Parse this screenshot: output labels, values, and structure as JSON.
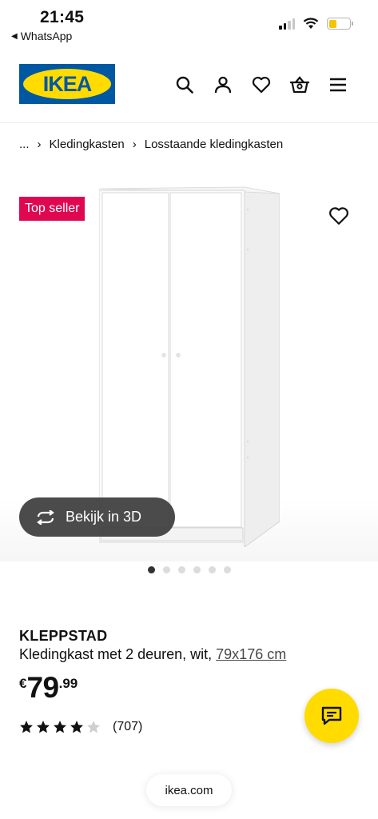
{
  "status_bar": {
    "time": "21:45",
    "back_app": "WhatsApp",
    "battery_color": "#f5c400"
  },
  "header": {
    "logo_text": "IKEA",
    "logo_colors": {
      "blue": "#0058a3",
      "yellow": "#ffdb00"
    },
    "icons": [
      "search-icon",
      "account-icon",
      "heart-icon",
      "basket-icon",
      "menu-icon"
    ]
  },
  "breadcrumb": {
    "ellipsis": "...",
    "items": [
      "Kledingkasten",
      "Losstaande kledingkasten"
    ]
  },
  "gallery": {
    "badge": "Top seller",
    "badge_color": "#e00751",
    "view_3d_label": "Bekijk in 3D",
    "dots_total": 6,
    "active_dot": 1
  },
  "product": {
    "name": "KLEPPSTAD",
    "description": "Kledingkast met 2 deuren, wit,",
    "size_link": "79x176 cm",
    "price": {
      "currency": "€",
      "integer": "79",
      "decimal": ".99"
    },
    "rating": {
      "stars": 4.5,
      "max": 5,
      "count": "(707)"
    }
  },
  "chat_button_color": "#ffdb00",
  "browser": {
    "url": "ikea.com"
  }
}
